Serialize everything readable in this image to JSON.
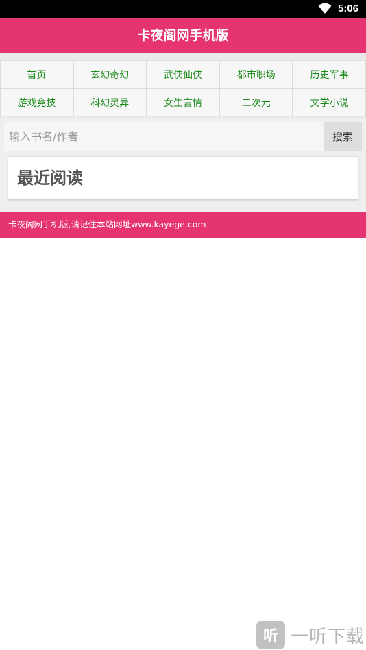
{
  "status_bar": {
    "time": "5:06",
    "wifi_icon": "wifi-icon"
  },
  "header": {
    "title": "卡夜阁网手机版",
    "color": "#e63371"
  },
  "nav": {
    "items": [
      {
        "label": "首页"
      },
      {
        "label": "玄幻奇幻"
      },
      {
        "label": "武侠仙侠"
      },
      {
        "label": "都市职场"
      },
      {
        "label": "历史军事"
      },
      {
        "label": "游戏竞技"
      },
      {
        "label": "科幻灵异"
      },
      {
        "label": "女生言情"
      },
      {
        "label": "二次元"
      },
      {
        "label": "文学小说"
      }
    ],
    "text_color": "#1a8a1a"
  },
  "search": {
    "placeholder": "输入书名/作者",
    "value": "",
    "button_label": "搜索"
  },
  "recent": {
    "title": "最近阅读"
  },
  "footer": {
    "text": "卡夜阁网手机版,请记住本站网址www.kayege.com"
  },
  "watermark": {
    "icon": "听",
    "text": "一听下载"
  }
}
